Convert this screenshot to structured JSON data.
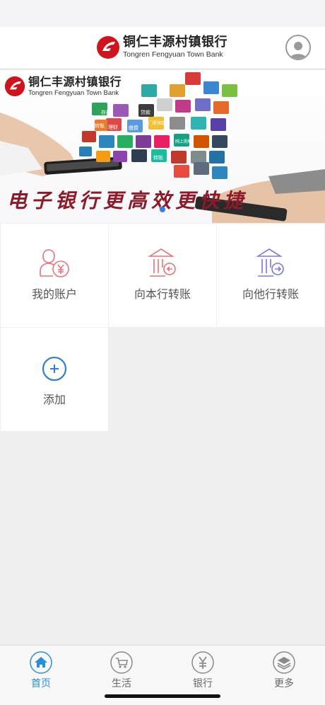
{
  "header": {
    "bank_name_cn": "铜仁丰源村镇银行",
    "bank_name_en": "Tongren Fengyuan Town Bank"
  },
  "banner": {
    "bank_name_cn": "铜仁丰源村镇银行",
    "bank_name_en": "Tongren Fengyuan Town Bank",
    "slogan": "电子银行更高效更快捷",
    "tile_labels": [
      "存款",
      "贷款",
      "转账",
      "理财",
      "缴费",
      "门票预定",
      "网上购物",
      "转账"
    ]
  },
  "functions": [
    {
      "label": "我的账户",
      "icon": "account-yuan-icon",
      "color": "#e8717a"
    },
    {
      "label": "向本行转账",
      "icon": "bank-transfer-icon",
      "color": "#e8717a"
    },
    {
      "label": "向他行转账",
      "icon": "other-bank-transfer-icon",
      "color": "#7b78d8"
    },
    {
      "label": "添加",
      "icon": "add-circle-icon",
      "color": "#2f7fd2"
    }
  ],
  "tabs": [
    {
      "label": "首页",
      "icon": "home-icon",
      "active": true
    },
    {
      "label": "生活",
      "icon": "cart-icon",
      "active": false
    },
    {
      "label": "银行",
      "icon": "yuan-icon",
      "active": false
    },
    {
      "label": "更多",
      "icon": "layers-icon",
      "active": false
    }
  ],
  "colors": {
    "brand_red": "#d0141e",
    "active_tab": "#2a8fd8",
    "slogan": "#8b1a2a"
  }
}
